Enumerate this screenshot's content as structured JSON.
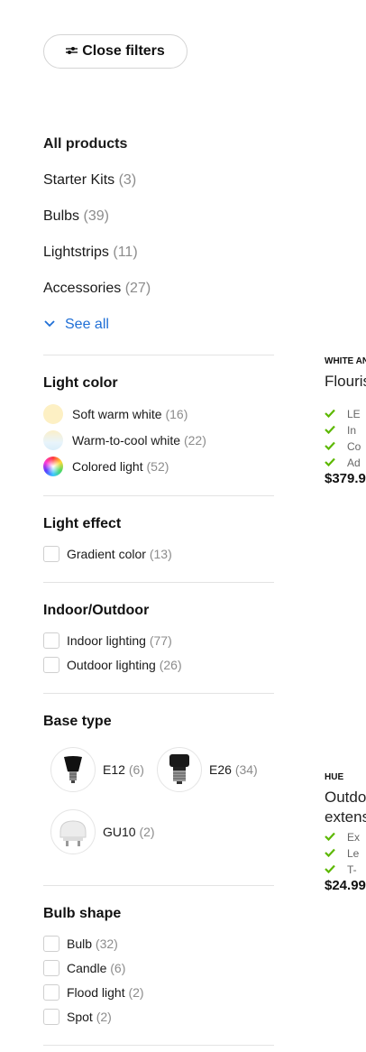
{
  "close_filters": {
    "label": "Close filters",
    "icon": "sliders-icon"
  },
  "categories": {
    "title": "All products",
    "items": [
      {
        "label": "Starter Kits",
        "count": "(3)"
      },
      {
        "label": "Bulbs",
        "count": "(39)"
      },
      {
        "label": "Lightstrips",
        "count": "(11)"
      },
      {
        "label": "Accessories",
        "count": "(27)"
      }
    ],
    "see_all": "See all"
  },
  "light_color": {
    "title": "Light color",
    "options": [
      {
        "label": "Soft warm white",
        "count": "(16)",
        "swatch": "#fdf0c4"
      },
      {
        "label": "Warm-to-cool white",
        "count": "(22)",
        "swatch": "#e6f3fb"
      },
      {
        "label": "Colored light",
        "count": "(52)",
        "swatch": "conic"
      }
    ]
  },
  "light_effect": {
    "title": "Light effect",
    "options": [
      {
        "label": "Gradient color",
        "count": "(13)"
      }
    ]
  },
  "indoor_outdoor": {
    "title": "Indoor/Outdoor",
    "options": [
      {
        "label": "Indoor lighting",
        "count": "(77)"
      },
      {
        "label": "Outdoor lighting",
        "count": "(26)"
      }
    ]
  },
  "base_type": {
    "title": "Base type",
    "options": [
      {
        "label": "E12",
        "count": "(6)",
        "icon": "e12-bulb-icon"
      },
      {
        "label": "E26",
        "count": "(34)",
        "icon": "e26-bulb-icon"
      },
      {
        "label": "GU10",
        "count": "(2)",
        "icon": "gu10-bulb-icon"
      }
    ]
  },
  "bulb_shape": {
    "title": "Bulb shape",
    "options": [
      {
        "label": "Bulb",
        "count": "(32)"
      },
      {
        "label": "Candle",
        "count": "(6)"
      },
      {
        "label": "Flood light",
        "count": "(2)"
      },
      {
        "label": "Spot",
        "count": "(2)"
      }
    ]
  },
  "products": [
    {
      "eyebrow": "WHITE AN",
      "name_lines": [
        "Flouris"
      ],
      "features": [
        "LE",
        "In",
        "Co",
        "Ad"
      ],
      "price": "$379.9"
    },
    {
      "eyebrow": "HUE",
      "name_lines": [
        "Outdo",
        "extens"
      ],
      "features": [
        "Ex",
        "Le",
        "T-"
      ],
      "price": "$24.99"
    }
  ],
  "colors": {
    "accent": "#1f6fd6",
    "check": "#5cb800",
    "muted": "#8c8c8c"
  }
}
